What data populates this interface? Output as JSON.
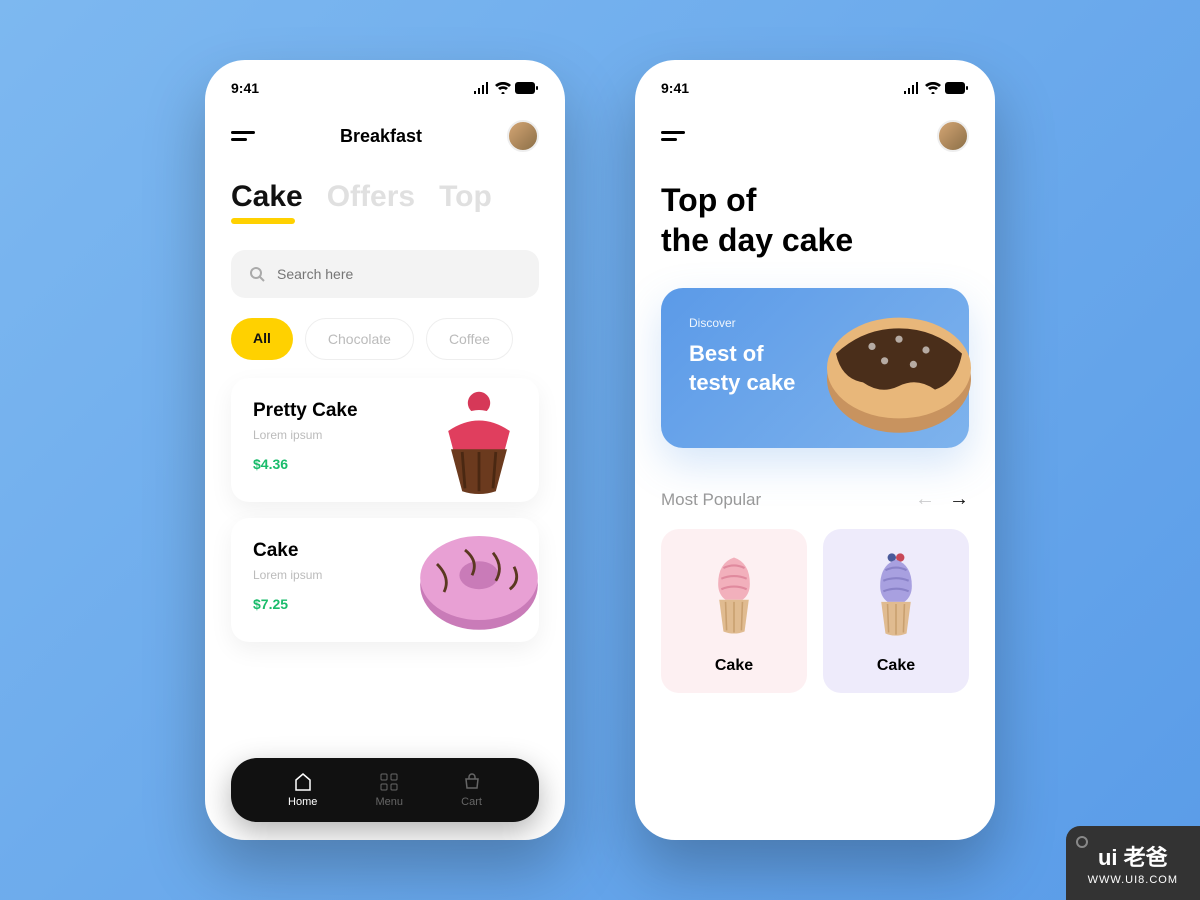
{
  "status": {
    "time": "9:41"
  },
  "left": {
    "header_title": "Breakfast",
    "tabs": [
      "Cake",
      "Offers",
      "Top"
    ],
    "search_placeholder": "Search here",
    "chips": [
      "All",
      "Chocolate",
      "Coffee"
    ],
    "products": [
      {
        "title": "Pretty Cake",
        "desc": "Lorem ipsum",
        "price": "$4.36"
      },
      {
        "title": "Cake",
        "desc": "Lorem ipsum",
        "price": "$7.25"
      }
    ],
    "nav": [
      "Home",
      "Menu",
      "Cart"
    ]
  },
  "right": {
    "title_line1": "Top of",
    "title_line2": "the day cake",
    "discover_small": "Discover",
    "discover_line1": "Best of",
    "discover_line2": "testy cake",
    "section": "Most Popular",
    "popular": [
      "Cake",
      "Cake"
    ]
  },
  "watermark": {
    "top": "ui 老爸",
    "bottom": "WWW.UI8.COM"
  }
}
